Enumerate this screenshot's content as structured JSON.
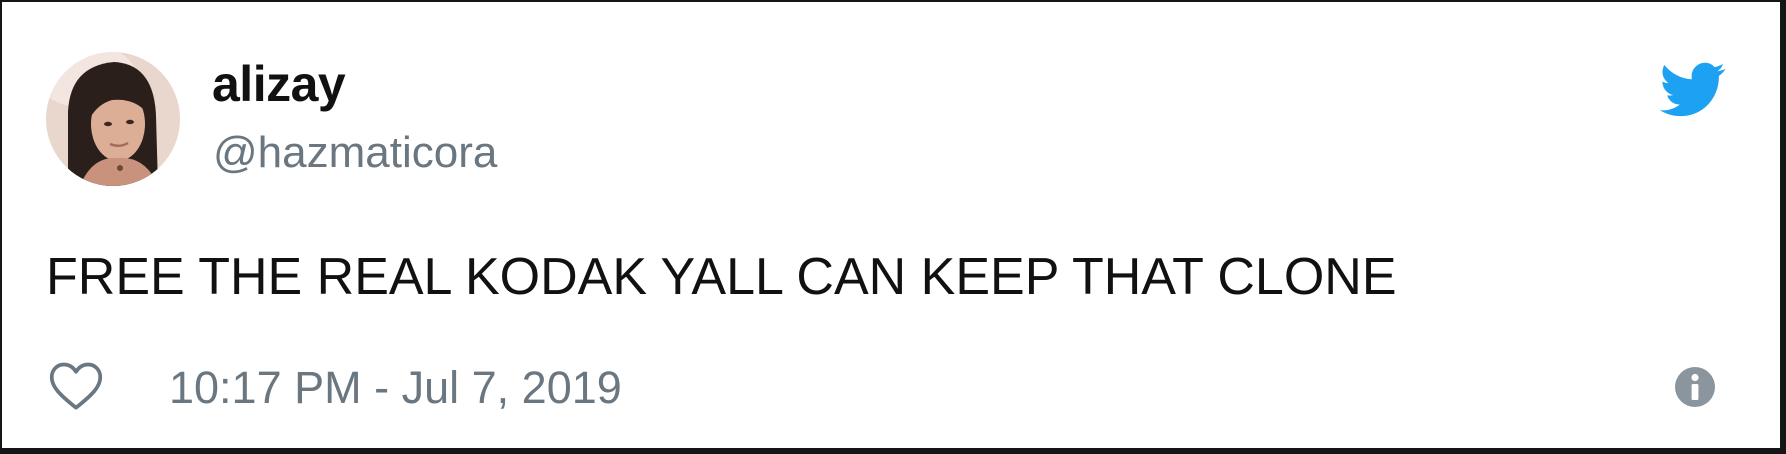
{
  "tweet": {
    "author": {
      "display_name": "alizay",
      "handle": "@hazmaticora",
      "avatar_icon": "profile-photo"
    },
    "text": "FREE THE REAL KODAK YALL CAN KEEP THAT CLONE",
    "timestamp": "10:17 PM - Jul 7, 2019"
  },
  "icons": {
    "brand": "twitter-bird-icon",
    "like": "heart-outline-icon",
    "info": "info-icon"
  },
  "colors": {
    "brand_blue": "#1da1f2",
    "muted_gray": "#6a7680",
    "text": "#111111",
    "card_background": "#ffffff"
  }
}
